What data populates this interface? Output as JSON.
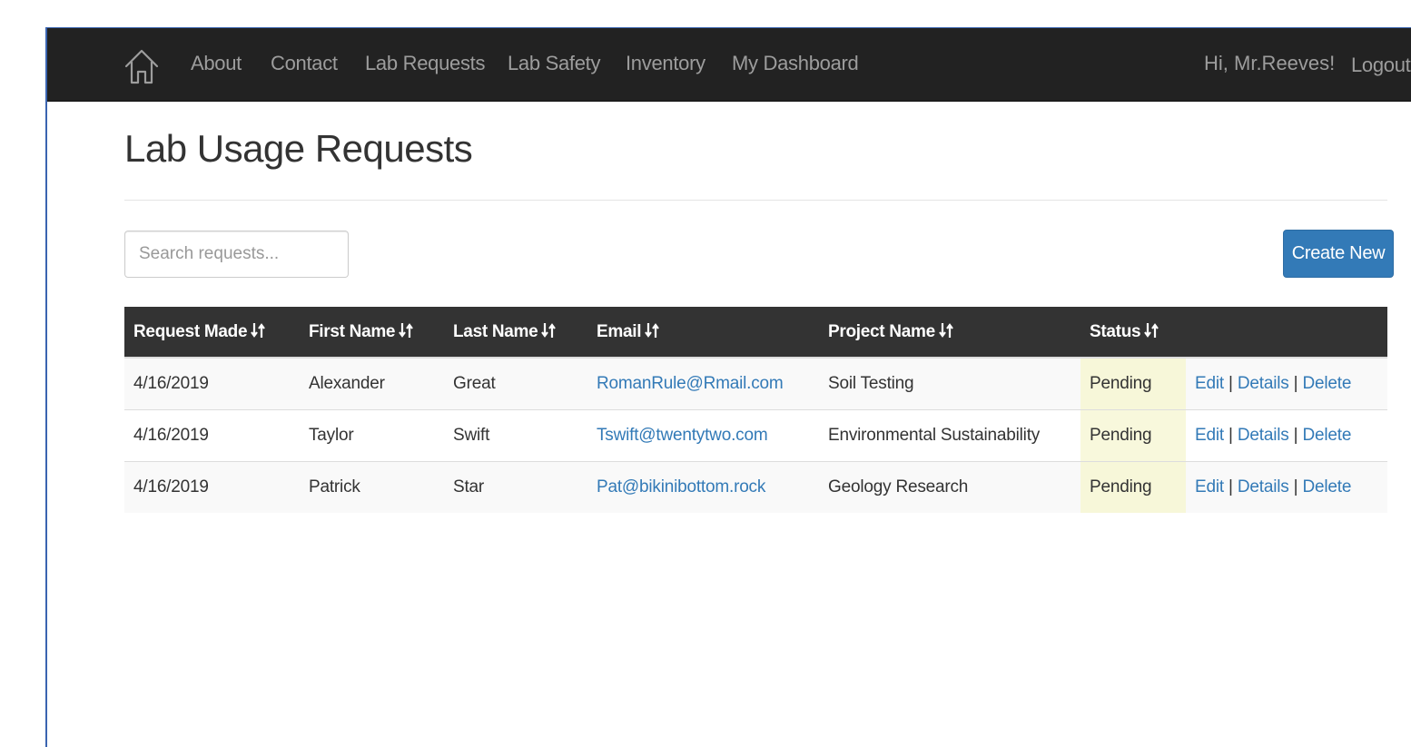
{
  "nav": {
    "home_icon": "home-icon",
    "links": [
      "About",
      "Contact",
      "Lab Requests",
      "Lab Safety",
      "Inventory",
      "My Dashboard"
    ],
    "greeting": "Hi, Mr.Reeves!",
    "logout": "Logout"
  },
  "page": {
    "title": "Lab Usage Requests"
  },
  "search": {
    "placeholder": "Search requests...",
    "value": ""
  },
  "toolbar": {
    "create_label": "Create New"
  },
  "table": {
    "sort_icon": "sort-arrows-icon",
    "headers": [
      "Request Made",
      "First Name",
      "Last Name",
      "Email",
      "Project Name",
      "Status"
    ],
    "rows": [
      {
        "request_made": "4/16/2019",
        "first_name": "Alexander",
        "last_name": "Great",
        "email": "RomanRule@Rmail.com",
        "project_name": "Soil Testing",
        "status": "Pending"
      },
      {
        "request_made": "4/16/2019",
        "first_name": "Taylor",
        "last_name": "Swift",
        "email": "Tswift@twentytwo.com",
        "project_name": "Environmental Sustainability",
        "status": "Pending"
      },
      {
        "request_made": "4/16/2019",
        "first_name": "Patrick",
        "last_name": "Star",
        "email": "Pat@bikinibottom.rock",
        "project_name": "Geology Research",
        "status": "Pending"
      }
    ],
    "actions": {
      "edit": "Edit",
      "details": "Details",
      "delete": "Delete",
      "separator": "|"
    }
  },
  "colors": {
    "navbar_bg": "#222222",
    "nav_text": "#9d9d9d",
    "primary": "#337ab7",
    "table_header_bg": "#333333",
    "status_highlight": "#f7f7d9",
    "window_border": "#3a64b0"
  }
}
